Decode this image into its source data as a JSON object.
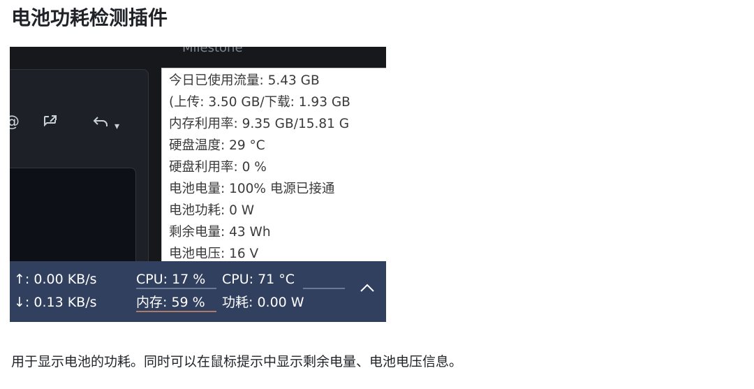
{
  "page": {
    "heading": "电池功耗检测插件",
    "caption": "用于显示电池的功耗。同时可以在鼠标提示中显示剩余电量、电池电压信息。"
  },
  "screenshot": {
    "app_title": "Milestone",
    "toolbar_icons": [
      "at-sign-icon",
      "share-icon",
      "reply-icon",
      "dropdown-arrow-icon"
    ],
    "tooltip_lines": [
      "今日已使用流量: 5.43 GB",
      " (上传: 3.50 GB/下载: 1.93 GB",
      "内存利用率: 9.35 GB/15.81 G",
      "硬盘温度: 29 °C",
      "硬盘利用率: 0 %",
      "电池电量: 100% 电源已接通",
      "电池功耗:  0 W",
      "剩余电量:  43 Wh",
      "电池电压:  16 V"
    ],
    "taskbar": {
      "upload_speed": "↑: 0.00 KB/s",
      "download_speed": "↓: 0.13 KB/s",
      "cpu_usage": "CPU: 17 %",
      "cpu_temp": "CPU: 71 °C",
      "memory_usage": "内存: 59 %",
      "power": "功耗: 0.00 W",
      "colors": {
        "background": "#324060",
        "cpu_bar": "#6b7a94",
        "mem_bar": "#b07a6a"
      }
    }
  }
}
